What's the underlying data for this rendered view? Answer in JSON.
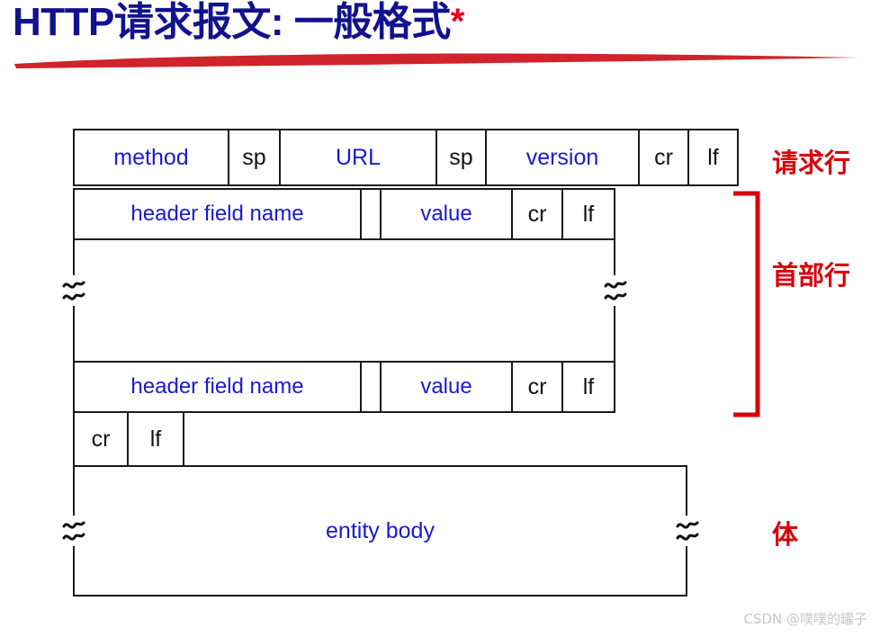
{
  "title": {
    "text": "HTTP请求报文: 一般格式",
    "asterisk": "*",
    "color": "#12128f",
    "accent_color": "#e8001c"
  },
  "colors": {
    "title_blue": "#12128f",
    "label_blue": "#1a1ad0",
    "label_black": "#121212",
    "annotation_red": "#d9000a",
    "underline_red": "#d0232b",
    "border_black": "#1a1a1a",
    "watermark_gray": "#c8c8c8"
  },
  "diagram": {
    "request_line": {
      "label": "请求行",
      "cells": [
        {
          "text": "method",
          "style": "blue"
        },
        {
          "text": "sp",
          "style": "black"
        },
        {
          "text": "URL",
          "style": "blue"
        },
        {
          "text": "sp",
          "style": "black"
        },
        {
          "text": "version",
          "style": "blue"
        },
        {
          "text": "cr",
          "style": "black"
        },
        {
          "text": "lf",
          "style": "black"
        }
      ]
    },
    "header_lines": {
      "label": "首部行",
      "first_row": [
        {
          "text": "header field name",
          "style": "blue"
        },
        {
          "text": "",
          "style": "plain"
        },
        {
          "text": "value",
          "style": "blue"
        },
        {
          "text": "cr",
          "style": "black"
        },
        {
          "text": "lf",
          "style": "black"
        }
      ],
      "last_row": [
        {
          "text": "header field name",
          "style": "blue"
        },
        {
          "text": "",
          "style": "plain"
        },
        {
          "text": "value",
          "style": "blue"
        },
        {
          "text": "cr",
          "style": "black"
        },
        {
          "text": "lf",
          "style": "black"
        }
      ],
      "continuation_symbol": "≈"
    },
    "blank_line": {
      "cells": [
        {
          "text": "cr",
          "style": "black"
        },
        {
          "text": "lf",
          "style": "black"
        }
      ]
    },
    "body": {
      "label": "体",
      "text": "entity body",
      "continuation_symbol": "≈"
    }
  },
  "watermark": {
    "text": "CSDN @噗噗的罐子"
  }
}
